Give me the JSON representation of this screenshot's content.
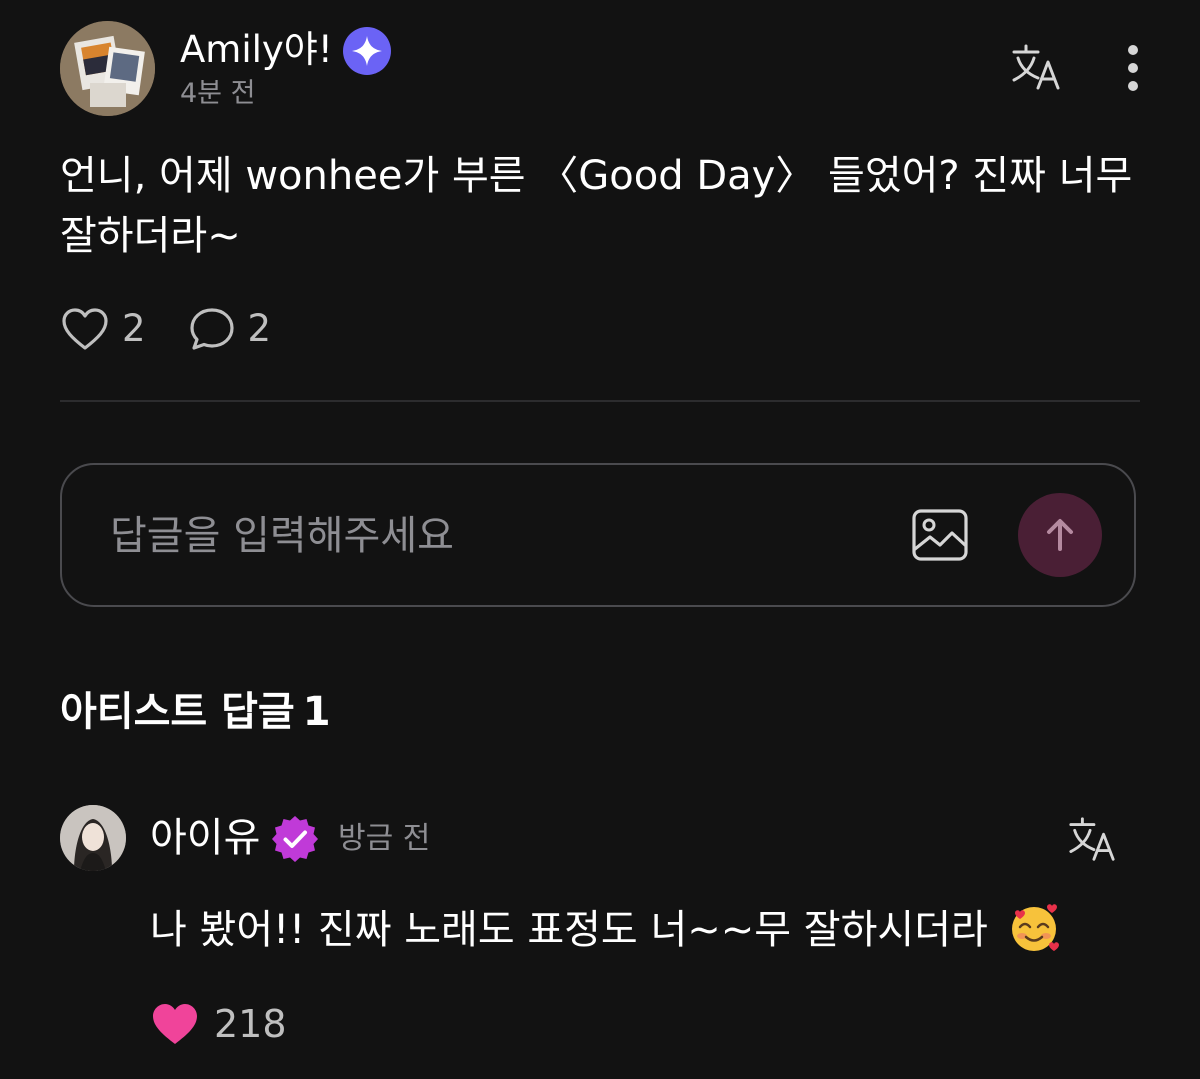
{
  "post": {
    "author": "Amily야!",
    "time": "4분 전",
    "body": "언니, 어제 wonhee가 부른 〈Good Day〉 들었어? 진짜 너무 잘하더라~",
    "likes": "2",
    "comments": "2",
    "badge_icon": "sparkle-badge-icon"
  },
  "reply_input": {
    "placeholder": "답글을 입력해주세요"
  },
  "artist_section": {
    "title": "아티스트 답글",
    "count": "1"
  },
  "artist_reply": {
    "name": "아이유",
    "time": "방금 전",
    "text": "나 봤어!! 진짜 노래도 표정도 너~~무 잘하시더라",
    "emoji": "smiling-face-with-hearts",
    "likes": "218"
  },
  "colors": {
    "background": "#121212",
    "fan_badge": "#6b63f5",
    "artist_badge": "#c03ad8",
    "liked_heart": "#f0449a",
    "send_button": "#4a1f35"
  }
}
